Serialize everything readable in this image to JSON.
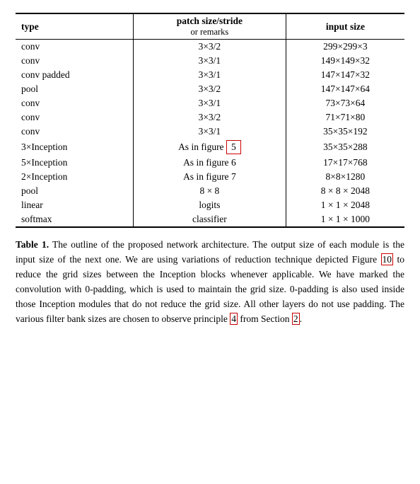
{
  "table": {
    "headers": {
      "col1": "type",
      "col2_top": "patch size/stride",
      "col2_sub": "or remarks",
      "col3": "input size"
    },
    "rows": [
      {
        "type": "conv",
        "patch": "3×3/2",
        "input": "299×299×3",
        "highlight": false
      },
      {
        "type": "conv",
        "patch": "3×3/1",
        "input": "149×149×32",
        "highlight": false
      },
      {
        "type": "conv padded",
        "patch": "3×3/1",
        "input": "147×147×32",
        "highlight": false
      },
      {
        "type": "pool",
        "patch": "3×3/2",
        "input": "147×147×64",
        "highlight": false
      },
      {
        "type": "conv",
        "patch": "3×3/1",
        "input": "73×73×64",
        "highlight": false
      },
      {
        "type": "conv",
        "patch": "3×3/2",
        "input": "71×71×80",
        "highlight": false
      },
      {
        "type": "conv",
        "patch": "3×3/1",
        "input": "35×35×192",
        "highlight": false
      },
      {
        "type": "3×Inception",
        "patch": "As in figure 5",
        "input": "35×35×288",
        "highlight": true,
        "ref": "5"
      },
      {
        "type": "5×Inception",
        "patch": "As in figure 6",
        "input": "17×17×768",
        "highlight": false,
        "ref": "6"
      },
      {
        "type": "2×Inception",
        "patch": "As in figure 7",
        "input": "8×8×1280",
        "highlight": false,
        "ref": "7"
      },
      {
        "type": "pool",
        "patch": "8 × 8",
        "input": "8 × 8 × 2048",
        "highlight": false
      },
      {
        "type": "linear",
        "patch": "logits",
        "input": "1 × 1 × 2048",
        "highlight": false
      },
      {
        "type": "softmax",
        "patch": "classifier",
        "input": "1 × 1 × 1000",
        "highlight": false
      }
    ]
  },
  "caption": {
    "label": "Table 1.",
    "text": " The outline of the proposed network architecture.  The output size of each module is the input size of the next one.  We are using variations of reduction technique depicted Figure ",
    "ref10": "10",
    "text2": " to reduce the grid sizes between the Inception blocks whenever applicable.  We have marked the convolution with 0-padding, which is used to maintain the grid size.  0-padding is also used inside those Inception modules that do not reduce the grid size.  All other layers do not use padding.  The various filter bank sizes are chosen to observe principle ",
    "ref4": "4",
    "text3": " from Section ",
    "ref2": "2",
    "text4": "."
  }
}
